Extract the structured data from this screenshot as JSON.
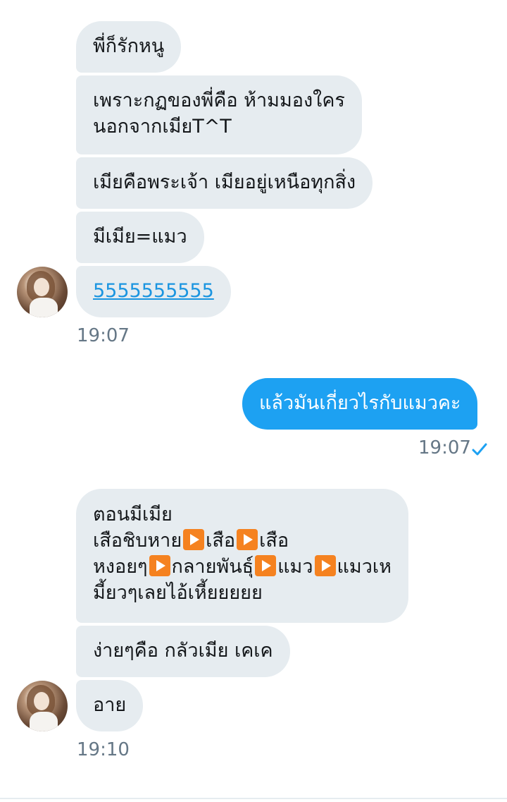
{
  "messages": {
    "r1": "พี่ก็รักหนู",
    "r2_line1": "เพราะกฏของพี่คือ ห้ามมองใคร",
    "r2_line2": "นอกจากเมียT^T",
    "r3": "เมียคือพระเจ้า เมียอยู่เหนือทุกสิ่ง",
    "r4": "มีเมีย=แมว",
    "r5_link": "5555555555",
    "s1": "แล้วมันเกี่ยวไรกับแมวคะ",
    "r6_line1": "ตอนมีเมีย",
    "r6_l2a": "เสือชิบหาย",
    "r6_l2b": "เสือ",
    "r6_l2c": "เสือ",
    "r6_l3a": "หงอยๆ",
    "r6_l3b": "กลายพันธุ์",
    "r6_l3c": "แมว",
    "r6_l3d": "แมวเห",
    "r6_line4": "มี้ยวๆเลยไอ้เหี้ยยยยย",
    "r7": "ง่ายๆคือ กลัวเมีย เคเค",
    "r8": "อาย"
  },
  "timestamps": {
    "group1": "19:07",
    "sent1": "19:07",
    "group2": "19:10"
  },
  "icons": {
    "avatar": "user-avatar",
    "read": "checkmark-icon",
    "play": "play-button-emoji"
  },
  "colors": {
    "received_bubble": "#e6ecf0",
    "sent_bubble": "#1da1f2",
    "link": "#1b95e0",
    "timestamp": "#657786",
    "play_emoji": "#f58220"
  }
}
